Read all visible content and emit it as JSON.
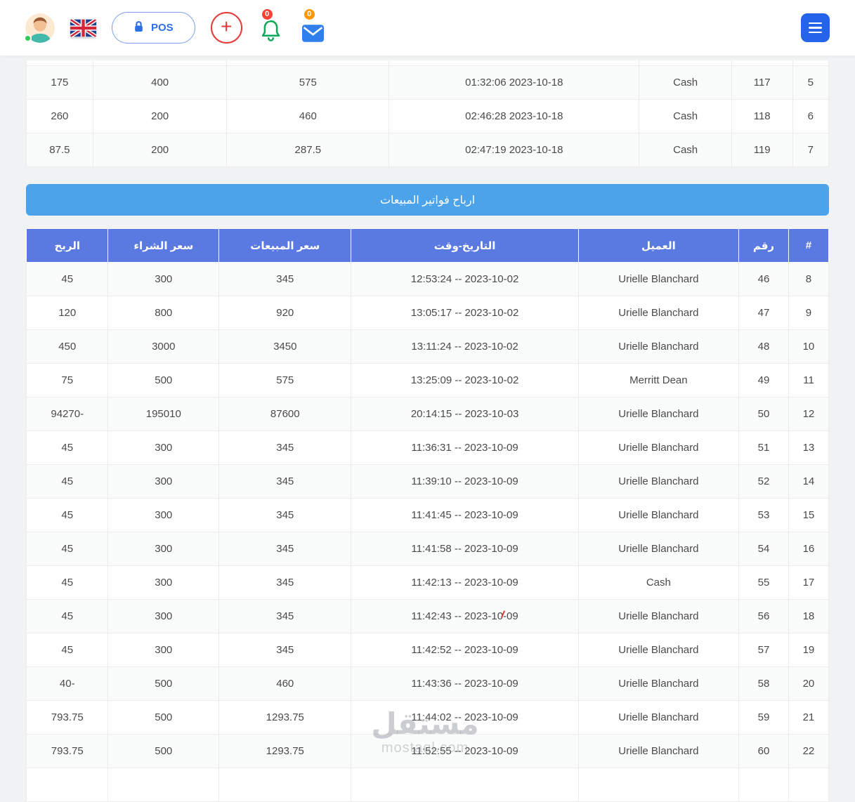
{
  "header": {
    "pos_button": "POS",
    "bell_badge": "0",
    "mail_badge": "0"
  },
  "top_table": {
    "rows": [
      {
        "profit": "175",
        "purchase": "400",
        "sales": "575",
        "datetime": "01:32:06 2023-10-18",
        "client": "Cash",
        "number": "117",
        "idx": "5"
      },
      {
        "profit": "260",
        "purchase": "200",
        "sales": "460",
        "datetime": "02:46:28 2023-10-18",
        "client": "Cash",
        "number": "118",
        "idx": "6"
      },
      {
        "profit": "87.5",
        "purchase": "200",
        "sales": "287.5",
        "datetime": "02:47:19 2023-10-18",
        "client": "Cash",
        "number": "119",
        "idx": "7"
      }
    ]
  },
  "banner": {
    "title": "ارباح فواتير المبيعات"
  },
  "sales_table": {
    "headers": {
      "profit": "الربح",
      "purchase": "سعر الشراء",
      "sales": "سعر المبيعات",
      "datetime": "التاريخ-وقت",
      "client": "العميل",
      "number": "رقم",
      "idx": "#"
    },
    "rows": [
      {
        "profit": "45",
        "purchase": "300",
        "sales": "345",
        "datetime": "12:53:24 -- 2023-10-02",
        "client": "Urielle Blanchard",
        "number": "46",
        "idx": "8"
      },
      {
        "profit": "120",
        "purchase": "800",
        "sales": "920",
        "datetime": "13:05:17 -- 2023-10-02",
        "client": "Urielle Blanchard",
        "number": "47",
        "idx": "9"
      },
      {
        "profit": "450",
        "purchase": "3000",
        "sales": "3450",
        "datetime": "13:11:24 -- 2023-10-02",
        "client": "Urielle Blanchard",
        "number": "48",
        "idx": "10"
      },
      {
        "profit": "75",
        "purchase": "500",
        "sales": "575",
        "datetime": "13:25:09 -- 2023-10-02",
        "client": "Merritt Dean",
        "number": "49",
        "idx": "11"
      },
      {
        "profit": "94270-",
        "purchase": "195010",
        "sales": "87600",
        "datetime": "20:14:15 -- 2023-10-03",
        "client": "Urielle Blanchard",
        "number": "50",
        "idx": "12"
      },
      {
        "profit": "45",
        "purchase": "300",
        "sales": "345",
        "datetime": "11:36:31 -- 2023-10-09",
        "client": "Urielle Blanchard",
        "number": "51",
        "idx": "13"
      },
      {
        "profit": "45",
        "purchase": "300",
        "sales": "345",
        "datetime": "11:39:10 -- 2023-10-09",
        "client": "Urielle Blanchard",
        "number": "52",
        "idx": "14"
      },
      {
        "profit": "45",
        "purchase": "300",
        "sales": "345",
        "datetime": "11:41:45 -- 2023-10-09",
        "client": "Urielle Blanchard",
        "number": "53",
        "idx": "15"
      },
      {
        "profit": "45",
        "purchase": "300",
        "sales": "345",
        "datetime": "11:41:58 -- 2023-10-09",
        "client": "Urielle Blanchard",
        "number": "54",
        "idx": "16"
      },
      {
        "profit": "45",
        "purchase": "300",
        "sales": "345",
        "datetime": "11:42:13 -- 2023-10-09",
        "client": "Cash",
        "number": "55",
        "idx": "17"
      },
      {
        "profit": "45",
        "purchase": "300",
        "sales": "345",
        "datetime": "11:42:43 -- 2023-10-09",
        "client": "Urielle Blanchard",
        "number": "56",
        "idx": "18"
      },
      {
        "profit": "45",
        "purchase": "300",
        "sales": "345",
        "datetime": "11:42:52 -- 2023-10-09",
        "client": "Urielle Blanchard",
        "number": "57",
        "idx": "19"
      },
      {
        "profit": "40-",
        "purchase": "500",
        "sales": "460",
        "datetime": "11:43:36 -- 2023-10-09",
        "client": "Urielle Blanchard",
        "number": "58",
        "idx": "20"
      },
      {
        "profit": "793.75",
        "purchase": "500",
        "sales": "1293.75",
        "datetime": "11:44:02 -- 2023-10-09",
        "client": "Urielle Blanchard",
        "number": "59",
        "idx": "21"
      },
      {
        "profit": "793.75",
        "purchase": "500",
        "sales": "1293.75",
        "datetime": "11:52:55 -- 2023-10-09",
        "client": "Urielle Blanchard",
        "number": "60",
        "idx": "22"
      }
    ]
  },
  "watermark": {
    "title": "مستقل",
    "domain": "mostaql.com"
  },
  "colors": {
    "banner_blue": "#4da3e9",
    "thead_blue": "#5a7ae2",
    "badge_red": "#f44336",
    "badge_orange": "#ff9800",
    "icon_green": "#0fa958",
    "accent_blue": "#2f6fe4",
    "menu_blue": "#2563eb",
    "plus_red": "#e53935"
  }
}
